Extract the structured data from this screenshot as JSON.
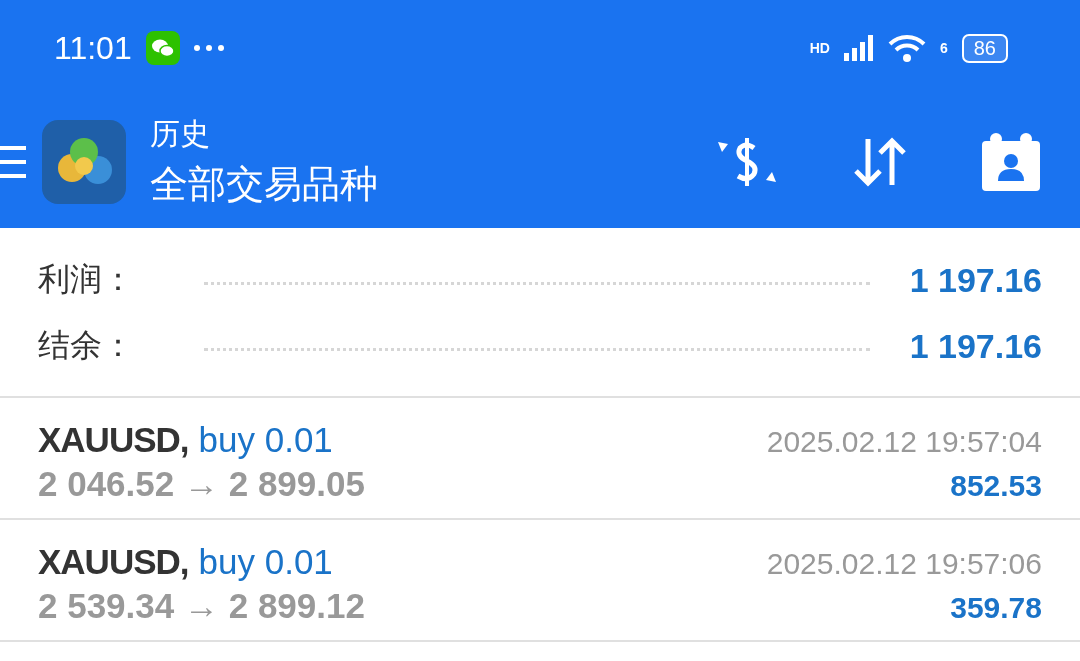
{
  "status_bar": {
    "time": "11:01",
    "network": "HD",
    "wifi": "6",
    "battery": "86"
  },
  "app_bar": {
    "title": "历史",
    "subtitle": "全部交易品种"
  },
  "summary": [
    {
      "label": "利润：",
      "value": "1 197.16"
    },
    {
      "label": "结余：",
      "value": "1 197.16"
    }
  ],
  "trades": [
    {
      "symbol": "XAUUSD,",
      "order": "buy 0.01",
      "time": "2025.02.12 19:57:04",
      "prices": "2 046.52 → 2 899.05",
      "profit": "852.53"
    },
    {
      "symbol": "XAUUSD,",
      "order": "buy 0.01",
      "time": "2025.02.12 19:57:06",
      "prices": "2 539.34 → 2 899.12",
      "profit": "359.78"
    }
  ]
}
